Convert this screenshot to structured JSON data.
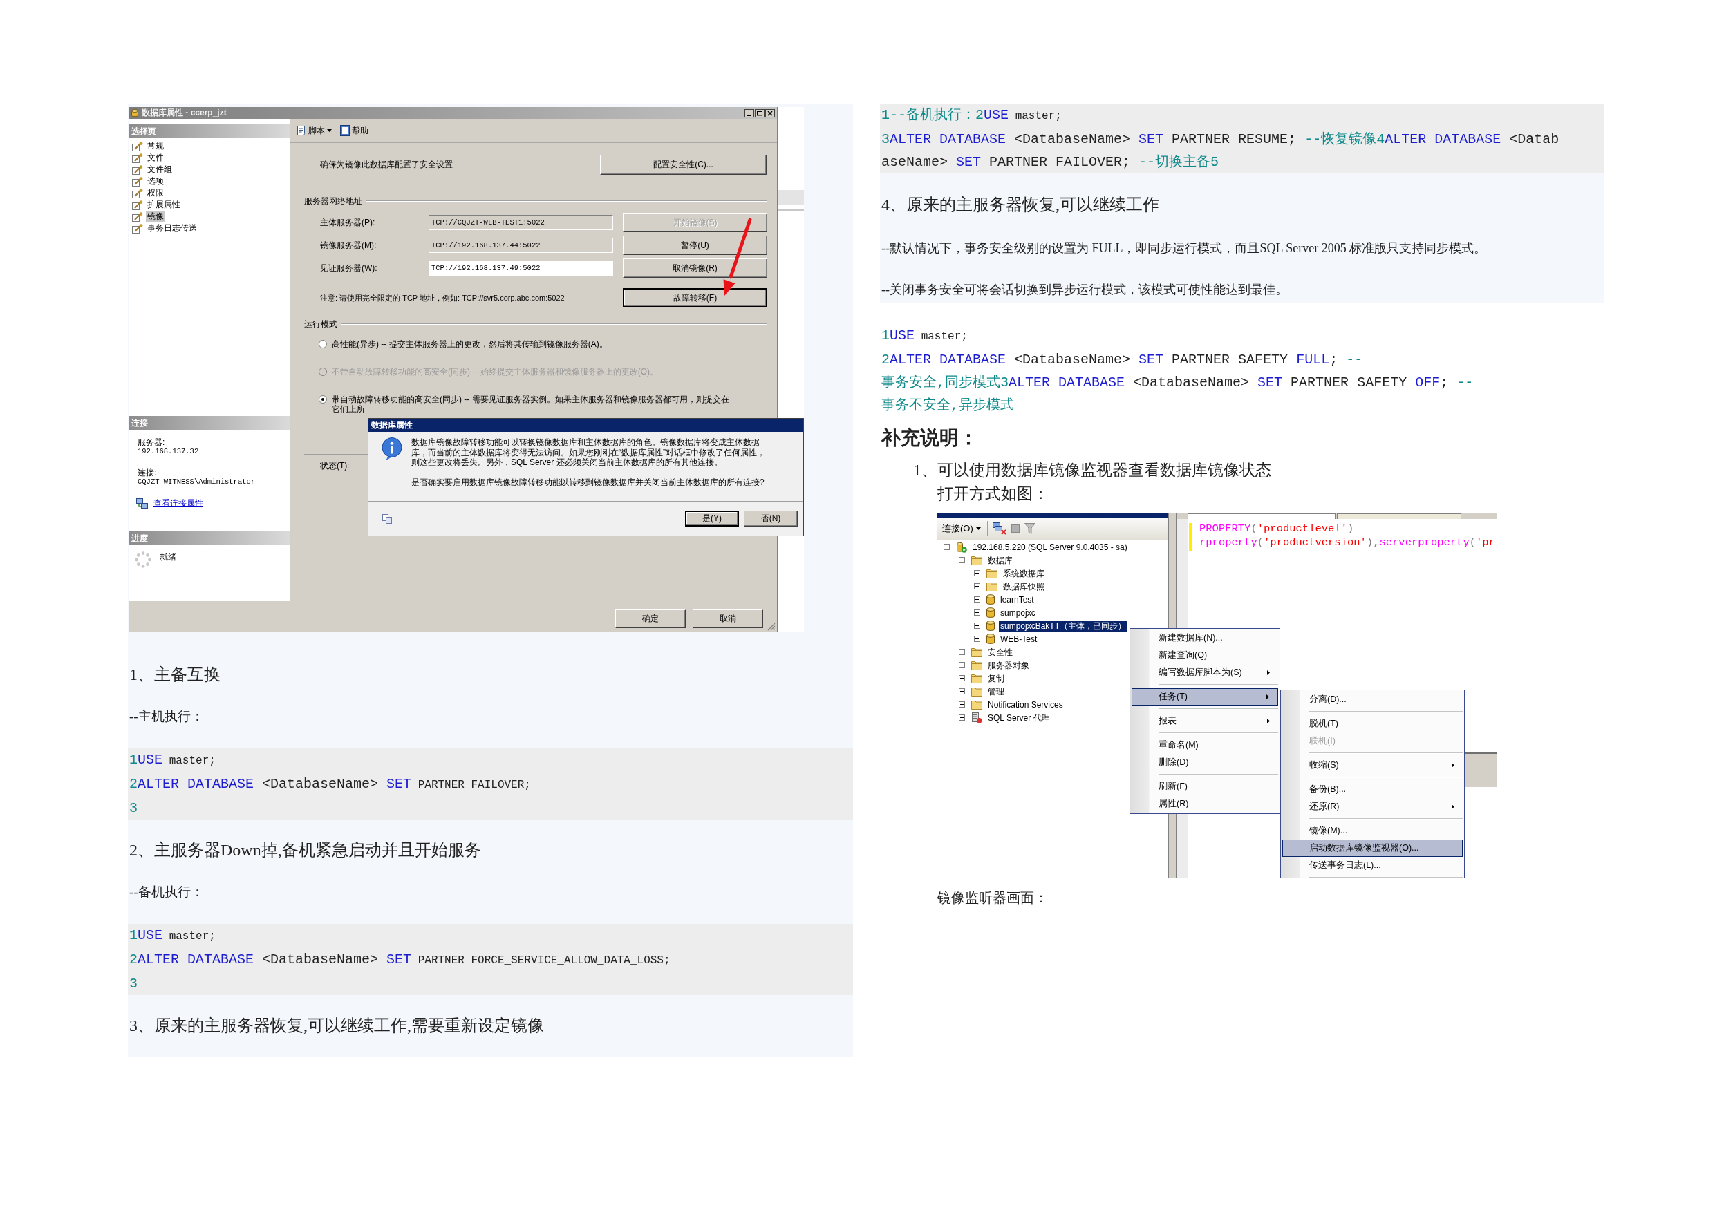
{
  "left_column": {
    "screenshot": {
      "title": "数据库属性 - ccerp_jzt",
      "select_page_heading": "选择页",
      "pages": [
        {
          "label": "常规",
          "selected": false
        },
        {
          "label": "文件",
          "selected": false
        },
        {
          "label": "文件组",
          "selected": false
        },
        {
          "label": "选项",
          "selected": false
        },
        {
          "label": "权限",
          "selected": false
        },
        {
          "label": "扩展属性",
          "selected": false
        },
        {
          "label": "镜像",
          "selected": true
        },
        {
          "label": "事务日志传送",
          "selected": false
        }
      ],
      "toolbar": [
        {
          "label": "脚本",
          "kind": "script",
          "has_menu": true
        },
        {
          "label": "帮助",
          "kind": "help",
          "has_menu": false
        }
      ],
      "security_text": "确保为镜像此数据库配置了安全设置",
      "security_button": "配置安全性(C)...",
      "address_section": "服务器网络地址",
      "servers": [
        {
          "label": "主体服务器(P):",
          "value": "TCP://CQJZT-WLB-TEST1:5022",
          "disabled": true
        },
        {
          "label": "镜像服务器(M):",
          "value": "TCP://192.168.137.44:5022",
          "disabled": true
        },
        {
          "label": "见证服务器(W):",
          "value": "TCP://192.168.137.49:5022",
          "disabled": false
        }
      ],
      "mirror_buttons": [
        {
          "label": "开始镜像(S)",
          "disabled": true,
          "default": false
        },
        {
          "label": "暂停(U)",
          "disabled": false,
          "default": false
        },
        {
          "label": "取消镜像(R)",
          "disabled": false,
          "default": false
        },
        {
          "label": "故障转移(F)",
          "disabled": false,
          "default": true
        }
      ],
      "note": "注意: 请使用完全限定的 TCP 地址，例如: TCP://svr5.corp.abc.com:5022",
      "mode_section": "运行模式",
      "modes": [
        {
          "lines": [
            "高性能(异步) -- 提交主体服务器上的更改，然后将其传输到镜像服务器(A)。"
          ],
          "selected": false,
          "disabled": false
        },
        {
          "lines": [
            "不带自动故障转移功能的高安全(同步) -- 始终提交主体服务器和镜像服务器上的更改(O)。"
          ],
          "selected": false,
          "disabled": true
        },
        {
          "lines": [
            "带自动故障转移功能的高安全(同步) -- 需要见证服务器实例。如果主体服务器和镜像服务器都可用，则提交在",
            "它们上所"
          ],
          "selected": true,
          "disabled": false
        }
      ],
      "status_label": "状态(T):",
      "connection_heading": "连接",
      "server_caption": "服务器:",
      "server_value": "192.168.137.32",
      "connection_caption": "连接:",
      "connection_value": "CQJZT-WITNESS\\Administrator",
      "connection_link": "查看连接属性",
      "progress_heading": "进度",
      "progress_status": "就绪",
      "footer_buttons": [
        "确定",
        "取消"
      ],
      "message_box": {
        "title": "数据库属性",
        "message": "数据库镜像故障转移功能可以转换镜像数据库和主体数据库的角色。镜像数据库将变成主体数据库，而当前的主体数据库将变得无法访问。如果您刚刚在“数据库属性”对话框中修改了任何属性，则这些更改将丢失。另外，SQL Server 还必须关闭当前主体数据库的所有其他连接。",
        "question": "是否确实要启用数据库镜像故障转移功能以转移到镜像数据库并关闭当前主体数据库的所有连接?",
        "buttons": [
          {
            "label": "是(Y)",
            "selected": true
          },
          {
            "label": "否(N)",
            "selected": false
          }
        ]
      }
    },
    "blocks": [
      {
        "kind": "heading",
        "text": "1、主备互换"
      },
      {
        "kind": "comment",
        "text": "--主机执行："
      },
      {
        "kind": "code",
        "shaded": true,
        "lines": [
          {
            "tokens": [
              {
                "kind": "line_no",
                "text": "1"
              },
              {
                "kind": "keyword",
                "text": "USE"
              },
              {
                "kind": "value",
                "text": " master;"
              }
            ]
          },
          {
            "tokens": [
              {
                "kind": "line_no",
                "text": "2"
              },
              {
                "kind": "keyword",
                "text": "ALTER DATABASE"
              },
              {
                "kind": "name",
                "text": " <DatabaseName> "
              },
              {
                "kind": "keyword",
                "text": "SET"
              },
              {
                "kind": "value",
                "text": " PARTNER FAILOVER;"
              }
            ]
          },
          {
            "tokens": [
              {
                "kind": "line_no",
                "text": "3"
              }
            ]
          }
        ]
      },
      {
        "kind": "heading",
        "text": "2、主服务器Down掉,备机紧急启动并且开始服务"
      },
      {
        "kind": "comment",
        "text": "--备机执行："
      },
      {
        "kind": "code",
        "shaded": true,
        "lines": [
          {
            "tokens": [
              {
                "kind": "line_no",
                "text": "1"
              },
              {
                "kind": "keyword",
                "text": "USE"
              },
              {
                "kind": "value",
                "text": " master;"
              }
            ]
          },
          {
            "tokens": [
              {
                "kind": "line_no",
                "text": "2"
              },
              {
                "kind": "keyword",
                "text": "ALTER DATABASE"
              },
              {
                "kind": "name",
                "text": " <DatabaseName> "
              },
              {
                "kind": "keyword",
                "text": "SET"
              },
              {
                "kind": "value",
                "text": " PARTNER FORCE_SERVICE_ALLOW_DATA_LOSS;"
              }
            ]
          },
          {
            "tokens": [
              {
                "kind": "line_no",
                "text": "3"
              }
            ]
          }
        ]
      },
      {
        "kind": "heading",
        "text": "3、原来的主服务器恢复,可以继续工作,需要重新设定镜像"
      }
    ]
  },
  "right_column": {
    "blocks": [
      {
        "kind": "code",
        "shaded": true,
        "lines": [
          {
            "tokens": [
              {
                "kind": "line_no",
                "text": "1"
              },
              {
                "kind": "comment",
                "text": "--备机执行："
              },
              {
                "kind": "line_no",
                "text": "2"
              },
              {
                "kind": "keyword",
                "text": "USE"
              },
              {
                "kind": "value",
                "text": " master;"
              }
            ]
          },
          {
            "tokens": [
              {
                "kind": "line_no",
                "text": "3"
              },
              {
                "kind": "keyword",
                "text": "ALTER DATABASE"
              },
              {
                "kind": "name",
                "text": " <DatabaseName> "
              },
              {
                "kind": "keyword",
                "text": "SET"
              },
              {
                "kind": "name",
                "text": " PARTNER RESUME; "
              },
              {
                "kind": "comment",
                "text": "--恢复镜像"
              },
              {
                "kind": "line_no",
                "text": "4"
              },
              {
                "kind": "keyword",
                "text": "ALTER DATABASE"
              },
              {
                "kind": "name",
                "text": " <Datab"
              }
            ]
          },
          {
            "tokens": [
              {
                "kind": "name",
                "text": "aseName> "
              },
              {
                "kind": "keyword",
                "text": "SET"
              },
              {
                "kind": "name",
                "text": " PARTNER FAILOVER; "
              },
              {
                "kind": "comment",
                "text": "--切换主备"
              },
              {
                "kind": "line_no",
                "text": "5"
              }
            ]
          }
        ]
      },
      {
        "kind": "panel",
        "items": [
          {
            "kind": "heading",
            "text": "4、原来的主服务器恢复,可以继续工作"
          },
          {
            "kind": "comment",
            "text": "--默认情况下，事务安全级别的设置为 FULL，即同步运行模式，而且SQL Server 2005 标准版只支持同步模式。"
          },
          {
            "kind": "comment",
            "text": "--关闭事务安全可将会话切换到异步运行模式，该模式可使性能达到最佳。"
          }
        ]
      },
      {
        "kind": "code",
        "shaded": false,
        "lines": [
          {
            "tokens": [
              {
                "kind": "line_no",
                "text": "1"
              },
              {
                "kind": "keyword",
                "text": "USE"
              },
              {
                "kind": "value",
                "text": " master;"
              }
            ]
          },
          {
            "tokens": [
              {
                "kind": "line_no",
                "text": "2"
              },
              {
                "kind": "keyword",
                "text": "ALTER DATABASE"
              },
              {
                "kind": "name",
                "text": " <DatabaseName> "
              },
              {
                "kind": "keyword",
                "text": "SET"
              },
              {
                "kind": "name",
                "text": " PARTNER SAFETY "
              },
              {
                "kind": "keyword",
                "text": "FULL"
              },
              {
                "kind": "name",
                "text": ";"
              },
              {
                "kind": "comment",
                "text": " --"
              }
            ]
          },
          {
            "tokens": [
              {
                "kind": "comment",
                "text": "事务安全,同步模式"
              },
              {
                "kind": "line_no",
                "text": "3"
              },
              {
                "kind": "keyword",
                "text": "ALTER DATABASE"
              },
              {
                "kind": "name",
                "text": " <DatabaseName> "
              },
              {
                "kind": "keyword",
                "text": "SET"
              },
              {
                "kind": "name",
                "text": " PARTNER SAFETY "
              },
              {
                "kind": "keyword",
                "text": "OFF"
              },
              {
                "kind": "name",
                "text": ";"
              },
              {
                "kind": "comment",
                "text": " --"
              }
            ]
          },
          {
            "tokens": [
              {
                "kind": "comment",
                "text": "事务不安全,异步模式"
              }
            ]
          }
        ]
      },
      {
        "kind": "title",
        "text": "补充说明："
      },
      {
        "kind": "list_item",
        "text": "1、可以使用数据库镜像监视器查看数据库镜像状态"
      },
      {
        "kind": "paragraph",
        "text": "打开方式如图："
      }
    ],
    "screenshot": {
      "connect_label": "连接(O)",
      "tree": [
        {
          "label": "192.168.5.220 (SQL Server 9.0.4035 - sa)",
          "kind": "server",
          "expanded": true,
          "selected": false,
          "children": [
            {
              "label": "数据库",
              "kind": "folder",
              "expanded": true,
              "selected": false,
              "children": [
                {
                  "label": "系统数据库",
                  "kind": "folder",
                  "expanded": false,
                  "selected": false
                },
                {
                  "label": "数据库快照",
                  "kind": "folder",
                  "expanded": false,
                  "selected": false
                },
                {
                  "label": "learnTest",
                  "kind": "database",
                  "expanded": false,
                  "selected": false
                },
                {
                  "label": "sumpojxc",
                  "kind": "database",
                  "expanded": false,
                  "selected": false
                },
                {
                  "label": "sumpojxcBakTT（主体，已同步）",
                  "kind": "database",
                  "expanded": false,
                  "selected": true
                },
                {
                  "label": "WEB-Test",
                  "kind": "database",
                  "expanded": false,
                  "selected": false
                }
              ]
            },
            {
              "label": "安全性",
              "kind": "folder",
              "expanded": false,
              "selected": false
            },
            {
              "label": "服务器对象",
              "kind": "folder",
              "expanded": false,
              "selected": false
            },
            {
              "label": "复制",
              "kind": "folder",
              "expanded": false,
              "selected": false
            },
            {
              "label": "管理",
              "kind": "folder",
              "expanded": false,
              "selected": false
            },
            {
              "label": "Notification Services",
              "kind": "folder",
              "expanded": false,
              "selected": false
            },
            {
              "label": "SQL Server 代理",
              "kind": "agent",
              "expanded": false,
              "selected": false
            }
          ]
        }
      ],
      "editor_lines": [
        {
          "tokens": [
            {
              "kind": "function",
              "text": "PROPERTY"
            },
            {
              "kind": "punct",
              "text": "("
            },
            {
              "kind": "string",
              "text": "'productlevel'"
            },
            {
              "kind": "punct",
              "text": ")"
            }
          ]
        },
        {
          "tokens": [
            {
              "kind": "function",
              "text": "rproperty"
            },
            {
              "kind": "punct",
              "text": "("
            },
            {
              "kind": "string",
              "text": "'productversion'"
            },
            {
              "kind": "punct",
              "text": "),"
            },
            {
              "kind": "function",
              "text": "serverproperty"
            },
            {
              "kind": "punct",
              "text": "("
            },
            {
              "kind": "string",
              "text": "'pr"
            }
          ]
        }
      ],
      "context_menu": [
        {
          "kind": "item",
          "label": "新建数据库(N)...",
          "selected": false,
          "disabled": false,
          "has_submenu": false
        },
        {
          "kind": "item",
          "label": "新建查询(Q)",
          "selected": false,
          "disabled": false,
          "has_submenu": false
        },
        {
          "kind": "item",
          "label": "编写数据库脚本为(S)",
          "selected": false,
          "disabled": false,
          "has_submenu": true
        },
        {
          "kind": "separator"
        },
        {
          "kind": "item",
          "label": "任务(T)",
          "selected": true,
          "disabled": false,
          "has_submenu": true
        },
        {
          "kind": "separator"
        },
        {
          "kind": "item",
          "label": "报表",
          "selected": false,
          "disabled": false,
          "has_submenu": true
        },
        {
          "kind": "separator"
        },
        {
          "kind": "item",
          "label": "重命名(M)",
          "selected": false,
          "disabled": false,
          "has_submenu": false
        },
        {
          "kind": "item",
          "label": "删除(D)",
          "selected": false,
          "disabled": false,
          "has_submenu": false
        },
        {
          "kind": "separator"
        },
        {
          "kind": "item",
          "label": "刷新(F)",
          "selected": false,
          "disabled": false,
          "has_submenu": false
        },
        {
          "kind": "item",
          "label": "属性(R)",
          "selected": false,
          "disabled": false,
          "has_submenu": false
        }
      ],
      "submenu": [
        {
          "kind": "item",
          "label": "分离(D)...",
          "selected": false,
          "disabled": false,
          "has_submenu": false
        },
        {
          "kind": "separator"
        },
        {
          "kind": "item",
          "label": "脱机(T)",
          "selected": false,
          "disabled": false,
          "has_submenu": false
        },
        {
          "kind": "item",
          "label": "联机(I)",
          "selected": false,
          "disabled": true,
          "has_submenu": false
        },
        {
          "kind": "separator"
        },
        {
          "kind": "item",
          "label": "收缩(S)",
          "selected": false,
          "disabled": false,
          "has_submenu": true
        },
        {
          "kind": "separator"
        },
        {
          "kind": "item",
          "label": "备份(B)...",
          "selected": false,
          "disabled": false,
          "has_submenu": false
        },
        {
          "kind": "item",
          "label": "还原(R)",
          "selected": false,
          "disabled": false,
          "has_submenu": true
        },
        {
          "kind": "separator"
        },
        {
          "kind": "item",
          "label": "镜像(M)...",
          "selected": false,
          "disabled": false,
          "has_submenu": false
        },
        {
          "kind": "item",
          "label": "启动数据库镜像监视器(O)...",
          "selected": true,
          "disabled": false,
          "has_submenu": false
        },
        {
          "kind": "item",
          "label": "传送事务日志(L)...",
          "selected": false,
          "disabled": false,
          "has_submenu": false
        },
        {
          "kind": "separator"
        }
      ]
    },
    "caption": "镜像监听器画面："
  }
}
